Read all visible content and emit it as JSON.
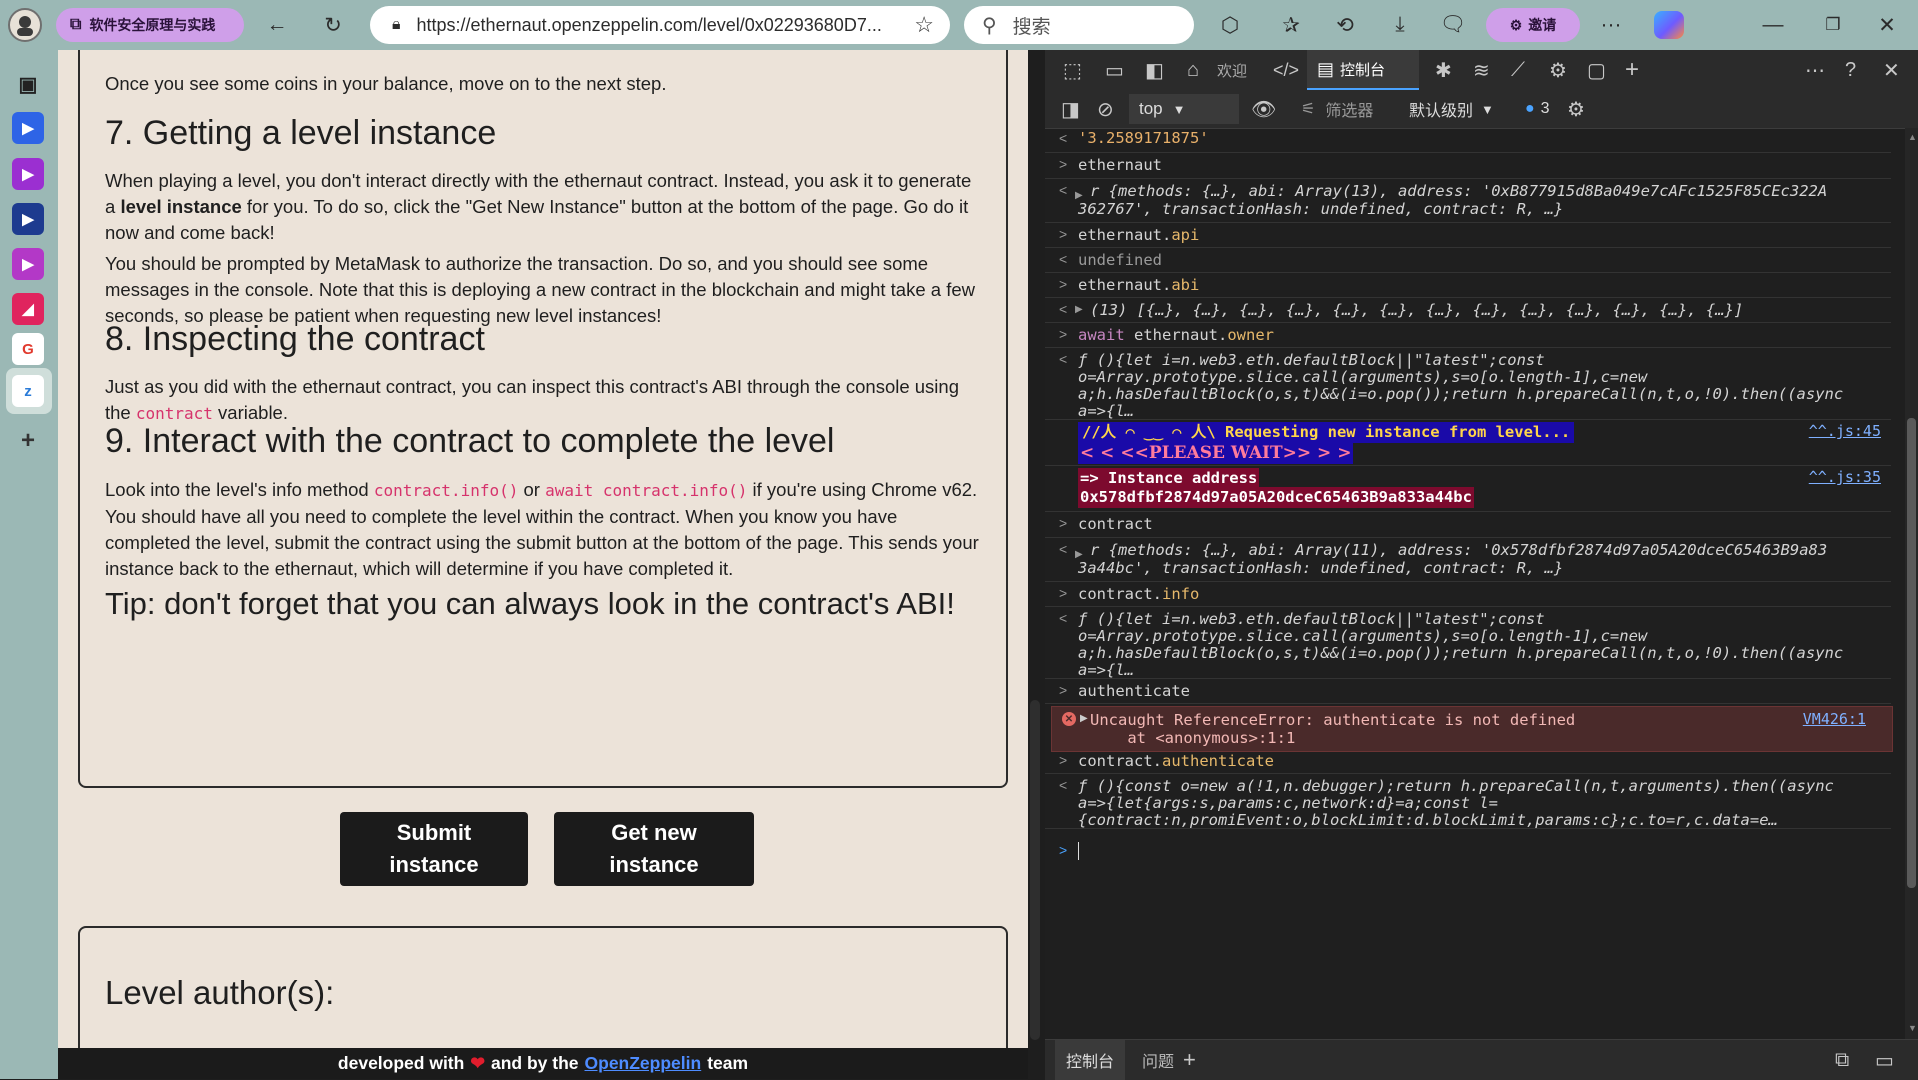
{
  "browser": {
    "tab_group_label": "软件安全原理与实践",
    "url": "https://ethernaut.openzeppelin.com/level/0x02293680D7...",
    "search_placeholder": "搜索",
    "invite_label": "邀请",
    "more_label": "···"
  },
  "page": {
    "intro_line": "Once you see some coins in your balance, move on to the next step.",
    "h7": "7. Getting a level instance",
    "p7a_1": "When playing a level, you don't interact directly with the ethernaut contract. Instead, you ask it to generate a ",
    "p7a_bold": "level instance",
    "p7a_2": " for you. To do so, click the \"Get New Instance\" button at the bottom of the page. Go do it now and come back!",
    "p7b": "You should be prompted by MetaMask to authorize the transaction. Do so, and you should see some messages in the console. Note that this is deploying a new contract in the blockchain and might take a few seconds, so please be patient when requesting new level instances!",
    "h8": "8. Inspecting the contract",
    "p8_1": "Just as you did with the ethernaut contract, you can inspect this contract's ABI through the console using the ",
    "p8_code": "contract",
    "p8_2": " variable.",
    "h9": "9. Interact with the contract to complete the level",
    "p9_1": "Look into the level's info method ",
    "p9_code1": "contract.info()",
    "p9_or": " or ",
    "p9_code2": "await contract.info()",
    "p9_2": " if you're using Chrome v62. You should have all you need to complete the level within the contract. When you know you have completed the level, submit the contract using the submit button at the bottom of the page. This sends your instance back to the ethernaut, which will determine if you have completed it.",
    "tip": "Tip: don't forget that you can always look in the contract's ABI!",
    "submit_btn_line1": "Submit",
    "submit_btn_line2": "instance",
    "getnew_btn_line1": "Get new",
    "getnew_btn_line2": "instance",
    "level_author": "Level author(s):",
    "footer_pre": "developed with",
    "footer_mid": "and  by the",
    "footer_link": "OpenZeppelin",
    "footer_post": "team"
  },
  "devtools": {
    "tab_welcome": "欢迎",
    "tab_console": "控制台",
    "filter_context": "top",
    "filter_placeholder": "筛选器",
    "level_select": "默认级别",
    "issues_count": "3",
    "bottom_tab_console": "控制台",
    "bottom_tab_issues": "问题",
    "log": {
      "r0": "'3.2589171875'",
      "r1": "ethernaut",
      "r2a": "r {methods: {…}, abi: Array(13), address: '0xB877915d8Ba049e7cAFc1525F85CEc322A",
      "r2b": "362767', transactionHash: undefined, contract: R, …}",
      "r3": "ethernaut.api",
      "r4": "undefined",
      "r5": "ethernaut.abi",
      "r6": "(13) [{…}, {…}, {…}, {…}, {…}, {…}, {…}, {…}, {…}, {…}, {…}, {…}, {…}]",
      "r7_kw": "await",
      "r7_obj": " ethernaut.",
      "r7_prop": "owner",
      "r8a": "ƒ (){let i=n.web3.eth.defaultBlock||\"latest\";const",
      "r8b": "o=Array.prototype.slice.call(arguments),s=o[o.length-1],c=new",
      "r8c": "a;h.hasDefaultBlock(o,s,t)&&(i=o.pop());return h.prepareCall(n,t,o,!0).then((async",
      "r8d": "a=>{l…",
      "req_line1": "//人 ⌒ ‿‿ ⌒ 人\\  Requesting new instance from level...",
      "req_line2": "< < <<PLEASE WAIT>> > >",
      "req_src": "^^.js:45",
      "inst_line1": "=> Instance address",
      "inst_line2": "0x578dfbf2874d97a05A20dceC65463B9a833a44bc",
      "inst_src": "^^.js:35",
      "r9": "contract",
      "r10a": "r {methods: {…}, abi: Array(11), address: '0x578dfbf2874d97a05A20dceC65463B9a83",
      "r10b": "3a44bc', transactionHash: undefined, contract: R, …}",
      "r11_obj": "contract.",
      "r11_prop": "info",
      "r12a": "ƒ (){let i=n.web3.eth.defaultBlock||\"latest\";const",
      "r12b": "o=Array.prototype.slice.call(arguments),s=o[o.length-1],c=new",
      "r12c": "a;h.hasDefaultBlock(o,s,t)&&(i=o.pop());return h.prepareCall(n,t,o,!0).then((async",
      "r12d": "a=>{l…",
      "r13": "authenticate",
      "err1": "Uncaught ReferenceError: authenticate is not defined",
      "err2": "    at <anonymous>:1:1",
      "err_src": "VM426:1",
      "r14_obj": "contract.",
      "r14_prop": "authenticate",
      "r15a": "ƒ (){const o=new a(!1,n.debugger);return h.prepareCall(n,t,arguments).then((async",
      "r15b": "a=>{let{args:s,params:c,network:d}=a;const l=",
      "r15c": "{contract:n,promiEvent:o,blockLimit:d.blockLimit,params:c};c.to=r,c.data=e…"
    }
  }
}
